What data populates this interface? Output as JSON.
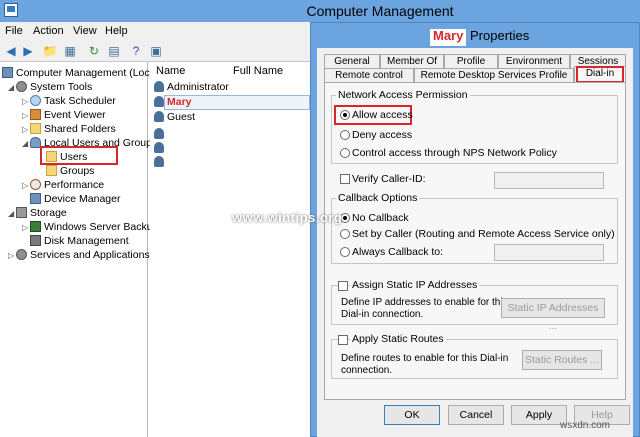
{
  "main_window": {
    "title": "Computer Management",
    "menu": [
      "File",
      "Action",
      "View",
      "Help"
    ],
    "tree": [
      {
        "label": "Computer Management (Local",
        "icon": "computer-icon"
      },
      {
        "label": "System Tools",
        "icon": "tools-icon"
      },
      {
        "label": "Task Scheduler",
        "icon": "clock-icon"
      },
      {
        "label": "Event Viewer",
        "icon": "event-icon"
      },
      {
        "label": "Shared Folders",
        "icon": "folder-icon"
      },
      {
        "label": "Local Users and Groups",
        "icon": "users-icon"
      },
      {
        "label": "Users",
        "icon": "folder-icon"
      },
      {
        "label": "Groups",
        "icon": "folder-icon"
      },
      {
        "label": "Performance",
        "icon": "performance-icon"
      },
      {
        "label": "Device Manager",
        "icon": "device-icon"
      },
      {
        "label": "Storage",
        "icon": "storage-icon"
      },
      {
        "label": "Windows Server Backup",
        "icon": "backup-icon"
      },
      {
        "label": "Disk Management",
        "icon": "disk-icon"
      },
      {
        "label": "Services and Applications",
        "icon": "services-icon"
      }
    ],
    "list_headers": {
      "name": "Name",
      "full_name": "Full Name"
    },
    "list_rows": [
      "Administrator",
      "Mary",
      "Guest"
    ]
  },
  "dialog": {
    "title_name": "Mary",
    "title_suffix": "Properties",
    "tabs_back": [
      "General",
      "Member Of",
      "Profile",
      "Environment",
      "Sessions"
    ],
    "tabs_front": [
      "Remote control",
      "Remote Desktop Services Profile",
      "Dial-in"
    ],
    "nap": {
      "legend": "Network Access Permission",
      "allow": "Allow access",
      "deny": "Deny access",
      "nps": "Control access through NPS Network Policy"
    },
    "verify_caller": "Verify Caller-ID:",
    "callback": {
      "legend": "Callback Options",
      "no": "No Callback",
      "set_by_caller": "Set by Caller (Routing and Remote Access Service only)",
      "always": "Always Callback to:"
    },
    "static_ip": {
      "checkbox": "Assign Static IP Addresses",
      "desc_line1": "Define IP addresses to enable for this",
      "desc_line2": "Dial-in connection.",
      "button": "Static IP Addresses ..."
    },
    "static_routes": {
      "checkbox": "Apply Static Routes",
      "desc_line1": "Define routes to enable for this Dial-in",
      "desc_line2": "connection.",
      "button": "Static Routes ..."
    },
    "buttons": {
      "ok": "OK",
      "cancel": "Cancel",
      "apply": "Apply",
      "help": "Help"
    }
  },
  "watermark": "www.wintips.org",
  "site_mark": "wsxdn.com",
  "colors": {
    "title_bar": "#6ba4df",
    "highlight_box": "#d9262c",
    "mary_label": "#d9262c"
  }
}
